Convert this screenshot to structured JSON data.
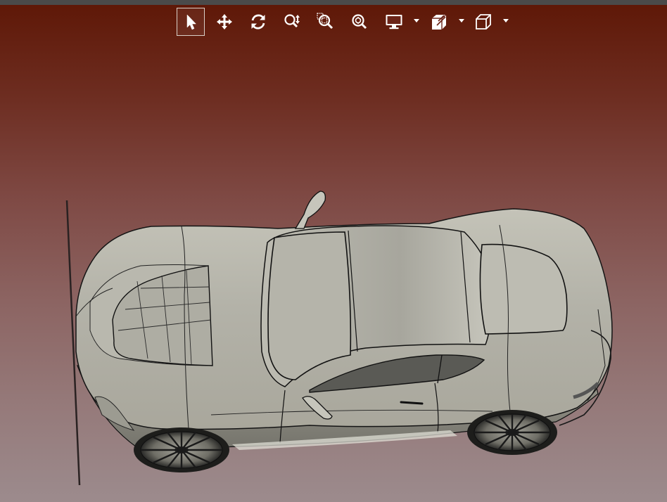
{
  "toolbar": {
    "tools": [
      {
        "name": "select",
        "icon": "cursor-icon",
        "active": true
      },
      {
        "name": "pan",
        "icon": "move-arrows-icon",
        "active": false
      },
      {
        "name": "rotate",
        "icon": "rotate-icon",
        "active": false
      },
      {
        "name": "zoom",
        "icon": "zoom-updown-icon",
        "active": false
      },
      {
        "name": "zoom-window",
        "icon": "zoom-window-icon",
        "active": false
      },
      {
        "name": "zoom-fit",
        "icon": "zoom-fit-icon",
        "active": false
      },
      {
        "name": "display-mode",
        "icon": "monitor-icon",
        "active": false,
        "has_dropdown": true
      },
      {
        "name": "section",
        "icon": "section-cube-icon",
        "active": false,
        "has_dropdown": true
      },
      {
        "name": "view-orientation",
        "icon": "cube-icon",
        "active": false,
        "has_dropdown": true
      }
    ]
  },
  "viewport": {
    "background_top": "#5e1706",
    "background_bottom": "#9c8b8d",
    "model_color": "#c9c7bd",
    "edge_color": "#1a1a1a"
  }
}
